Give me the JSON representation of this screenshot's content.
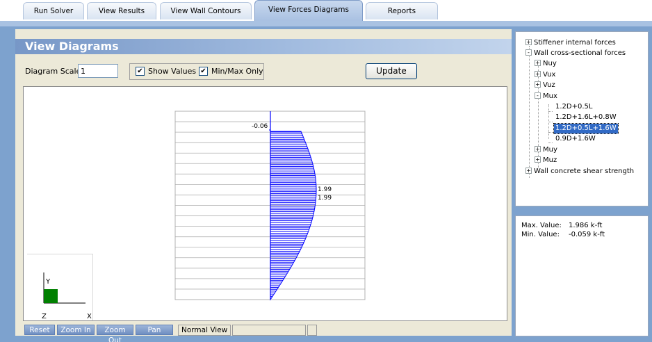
{
  "tabs": [
    {
      "label": "Run Solver",
      "active": false
    },
    {
      "label": "View Results",
      "active": false
    },
    {
      "label": "View Wall Contours",
      "active": false
    },
    {
      "label": "View Forces Diagrams",
      "active": true
    },
    {
      "label": "Reports",
      "active": false
    }
  ],
  "panel": {
    "title": "View Diagrams"
  },
  "controls": {
    "diagram_scale_label": "Diagram Scale:",
    "diagram_scale_value": "1",
    "show_values_label": "Show Values",
    "show_values_checked": true,
    "minmax_label": "Min/Max Only",
    "minmax_checked": true,
    "update_label": "Update"
  },
  "diagram": {
    "value_labels": {
      "min": "-0.06",
      "max_a": "1.99",
      "max_b": "1.99"
    },
    "axis_labels": {
      "y": "Y",
      "z": "Z",
      "x": "X"
    },
    "fill_color": "#0000ff",
    "axis_marker_color": "#008000"
  },
  "bottom_bar": {
    "buttons": [
      "Reset",
      "Zoom In",
      "Zoom Out",
      "Pan"
    ],
    "view_mode": "Normal View"
  },
  "tree": {
    "items": [
      {
        "label": "Stiffener internal forces",
        "toggle": "+"
      },
      {
        "label": "Wall cross-sectional forces",
        "toggle": "-"
      },
      {
        "label": "Nuy",
        "toggle": "+"
      },
      {
        "label": "Vux",
        "toggle": "+"
      },
      {
        "label": "Vuz",
        "toggle": "+"
      },
      {
        "label": "Mux",
        "toggle": "-"
      },
      {
        "label": "1.2D+0.5L",
        "toggle": ""
      },
      {
        "label": "1.2D+1.6L+0.8W",
        "toggle": ""
      },
      {
        "label": "1.2D+0.5L+1.6W",
        "toggle": "",
        "selected": true
      },
      {
        "label": "0.9D+1.6W",
        "toggle": ""
      },
      {
        "label": "Muy",
        "toggle": "+"
      },
      {
        "label": "Muz",
        "toggle": "+"
      },
      {
        "label": "Wall concrete shear strength",
        "toggle": "+"
      }
    ]
  },
  "info": {
    "max_label": "Max. Value:",
    "max_value": "1.986 k-ft",
    "min_label": "Min. Value:",
    "min_value": "-0.059 k-ft"
  }
}
